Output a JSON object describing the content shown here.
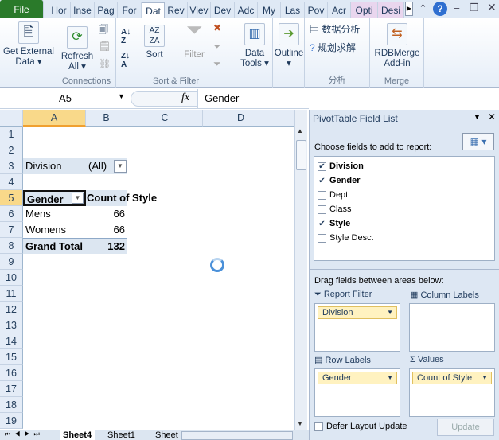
{
  "tabs": [
    "File",
    "Hor",
    "Inse",
    "Pag",
    "For",
    "Dat",
    "Rev",
    "Viev",
    "Dev",
    "Adc",
    "My",
    "Las",
    "Pov",
    "Acr",
    "Opti",
    "Desi"
  ],
  "ribbon": {
    "get_external": "Get External",
    "get_external2": "Data",
    "refresh": "Refresh",
    "refresh2": "All",
    "connections": "Connections",
    "sort": "Sort",
    "filter": "Filter",
    "sort_filter": "Sort & Filter",
    "data_tools": "Data",
    "data_tools2": "Tools",
    "outline": "Outline",
    "analysis1": "数据分析",
    "analysis2": "规划求解",
    "analysis_group": "分析",
    "rdb": "RDBMerge",
    "rdb2": "Add-in",
    "merge": "Merge"
  },
  "formula": {
    "name_box": "A5",
    "fx": "fx",
    "value": "Gender"
  },
  "columns": [
    "A",
    "B",
    "C",
    "D"
  ],
  "rows": [
    "1",
    "2",
    "3",
    "4",
    "5",
    "6",
    "7",
    "8",
    "9",
    "10",
    "11",
    "12",
    "13",
    "14",
    "15",
    "16",
    "17",
    "18",
    "19"
  ],
  "pivot": {
    "filter_field": "Division",
    "filter_value": "(All)",
    "row_header": "Gender",
    "value_header": "Count of Style",
    "items": [
      {
        "label": "Mens",
        "value": "66"
      },
      {
        "label": "Womens",
        "value": "66"
      }
    ],
    "total_label": "Grand Total",
    "total_value": "132"
  },
  "sheets": [
    "Sheet4",
    "Sheet1",
    "Sheet"
  ],
  "pane": {
    "title": "PivotTable Field List",
    "choose": "Choose fields to add to report:",
    "fields": [
      {
        "label": "Division",
        "checked": true
      },
      {
        "label": "Gender",
        "checked": true
      },
      {
        "label": "Dept",
        "checked": false
      },
      {
        "label": "Class",
        "checked": false
      },
      {
        "label": "Style",
        "checked": true
      },
      {
        "label": "Style Desc.",
        "checked": false
      }
    ],
    "drag": "Drag fields between areas below:",
    "report_filter": "Report Filter",
    "column_labels": "Column Labels",
    "row_labels": "Row Labels",
    "values": "Values",
    "filter_pill": "Division",
    "row_pill": "Gender",
    "values_pill": "Count of Style",
    "defer": "Defer Layout Update",
    "update": "Update"
  }
}
